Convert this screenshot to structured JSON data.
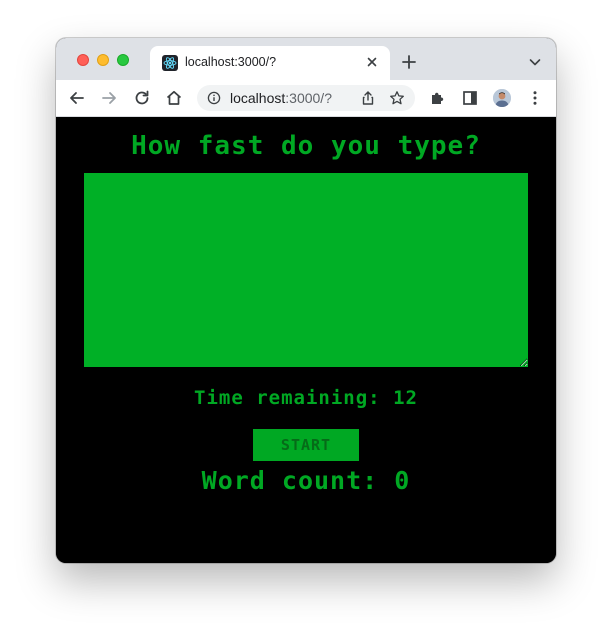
{
  "browser": {
    "tab": {
      "title": "localhost:3000/?",
      "favicon": "react-logo-icon"
    },
    "address_bar": {
      "host": "localhost",
      "path": ":3000/?"
    },
    "icons": {
      "back": "back-arrow-icon",
      "forward": "forward-arrow-icon",
      "reload": "reload-icon",
      "home": "home-icon",
      "site_info": "info-icon",
      "share": "share-icon",
      "bookmark": "star-icon",
      "extensions": "puzzle-icon",
      "side_panel": "side-panel-icon",
      "menu": "kebab-menu-icon",
      "new_tab": "plus-icon",
      "close_tab": "close-icon",
      "tab_search": "chevron-down-icon"
    }
  },
  "app": {
    "heading": "How fast do you type?",
    "textarea_value": "",
    "time_label": "Time remaining:",
    "time_remaining": "12",
    "start_label": "START",
    "word_count_label": "Word count:",
    "word_count": "0"
  },
  "colors": {
    "background": "#000000",
    "accent_green": "#00a823",
    "textarea_green": "#00b026",
    "button_text": "#066b18"
  }
}
